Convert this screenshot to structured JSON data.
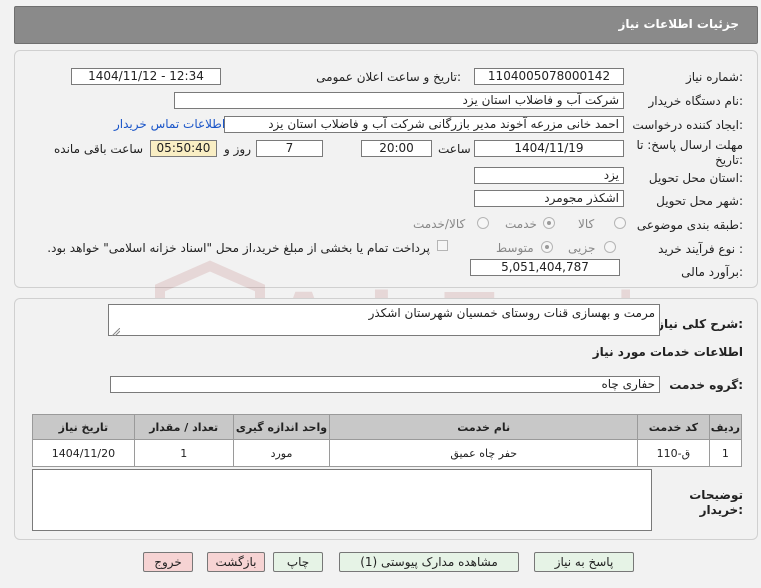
{
  "header": {
    "title": "جزئیات اطلاعات نیاز"
  },
  "form": {
    "need_number_label": "شماره نیاز:",
    "need_number": "1104005078000142",
    "announce_label": "تاریخ و ساعت اعلان عمومی:",
    "announce_value": "1404/11/12 - 12:34",
    "buyer_org_label": "نام دستگاه خریدار:",
    "buyer_org": "شرکت آب و فاضلاب استان یزد",
    "creator_label": "ایجاد کننده درخواست:",
    "creator": "احمد خانی مزرعه آخوند مدیر بازرگانی شرکت آب و فاضلاب استان یزد",
    "contact_link": "اطلاعات تماس خریدار",
    "deadline_label_1": "مهلت ارسال پاسخ: تا",
    "deadline_label_2": "تاریخ:",
    "deadline_date": "1404/11/19",
    "time_label": "ساعت",
    "deadline_time": "20:00",
    "days_value": "7",
    "days_label": "روز و",
    "remaining_time": "05:50:40",
    "remaining_label": "ساعت باقی مانده",
    "province_label": "استان محل تحویل:",
    "province": "یزد",
    "city_label": "شهر محل تحویل:",
    "city": "اشکذر مجومرد",
    "category_label": "طبقه بندی موضوعی:",
    "category_options": [
      "کالا",
      "خدمت",
      "کالا/خدمت"
    ],
    "category_selected": "خدمت",
    "process_label": "نوع فرآیند خرید :",
    "process_options": [
      "جزیی",
      "متوسط"
    ],
    "process_selected": "متوسط",
    "treasury_note": "پرداخت تمام یا بخشی از مبلغ خرید،از محل \"اسناد خزانه اسلامی\" خواهد بود.",
    "estimate_label": "برآورد مالی:",
    "estimate": "5,051,404,787"
  },
  "details": {
    "summary_label": "شرح کلی نیاز:",
    "summary": "مرمت و بهسازی قنات روستای خمسیان شهرستان اشکذر",
    "services_title": "اطلاعات خدمات مورد نیاز",
    "group_label": "گروه خدمت:",
    "group": "حفاری چاه",
    "table": {
      "headers": [
        "ردیف",
        "کد خدمت",
        "نام خدمت",
        "واحد اندازه گیری",
        "تعداد / مقدار",
        "تاریخ نیاز"
      ],
      "rows": [
        [
          "1",
          "ق-110",
          "حفر چاه عمیق",
          "مورد",
          "1",
          "1404/11/20"
        ]
      ]
    },
    "buyer_notes_label_1": "توضیحات",
    "buyer_notes_label_2": "خریدار:",
    "buyer_notes": ""
  },
  "buttons": {
    "reply": "پاسخ به نیاز",
    "attachments": "مشاهده مدارک پیوستی (1)",
    "print": "چاپ",
    "back": "بازگشت",
    "exit": "خروج"
  },
  "watermark": {
    "text": "AriaTender.neT"
  }
}
